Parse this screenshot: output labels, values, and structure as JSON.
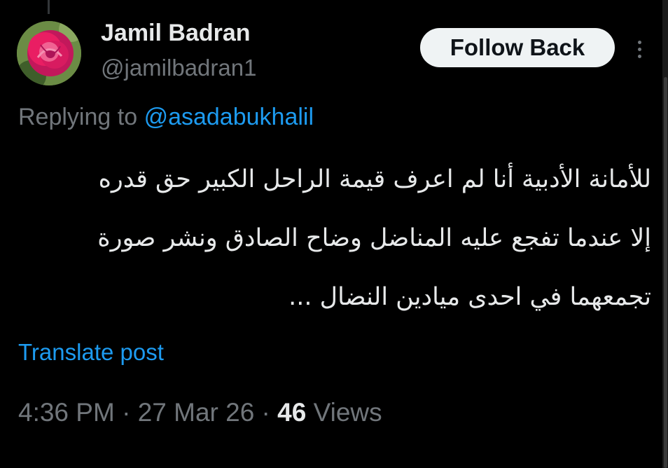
{
  "author": {
    "name": "Jamil Badran",
    "handle": "@jamilbadran1",
    "avatar_icon": "pink-rose-avatar"
  },
  "actions": {
    "follow_label": "Follow Back",
    "more_icon": "more-vertical-icon"
  },
  "reply": {
    "prefix": "Replying to",
    "mention": "@asadabukhalil"
  },
  "post": {
    "lines": [
      "للأمانة الأدبية أنا لم اعرف قيمة الراحل الكبير حق قدره",
      "إلا عندما تفجع عليه المناضل وضاح الصادق ونشر صورة",
      "تجمعهما في احدى ميادين النضال ..."
    ]
  },
  "translate_label": "Translate post",
  "meta": {
    "time": "4:36 PM",
    "separator": " · ",
    "date": "27 Mar 26",
    "views_count": "46",
    "views_label": "Views"
  },
  "colors": {
    "background": "#000000",
    "text": "#e7e9ea",
    "secondary": "#71767b",
    "link": "#1d9bf0",
    "button_bg": "#eff3f4"
  }
}
